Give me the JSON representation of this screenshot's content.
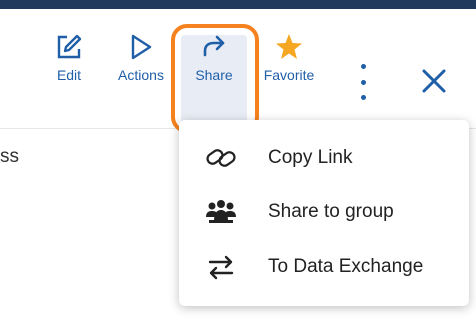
{
  "toolbar": {
    "edit_label": "Edit",
    "actions_label": "Actions",
    "share_label": "Share",
    "favorite_label": "Favorite"
  },
  "background": {
    "partial_text": "ss"
  },
  "share_menu": {
    "items": [
      {
        "label": "Copy Link",
        "icon": "link-icon"
      },
      {
        "label": "Share to group",
        "icon": "group-icon"
      },
      {
        "label": "To Data Exchange",
        "icon": "swap-arrows-icon"
      }
    ]
  },
  "colors": {
    "accent": "#1f5fa8",
    "highlight": "#f5821f",
    "favorite_star": "#f5a623",
    "top_bar": "#1f3a5c"
  }
}
